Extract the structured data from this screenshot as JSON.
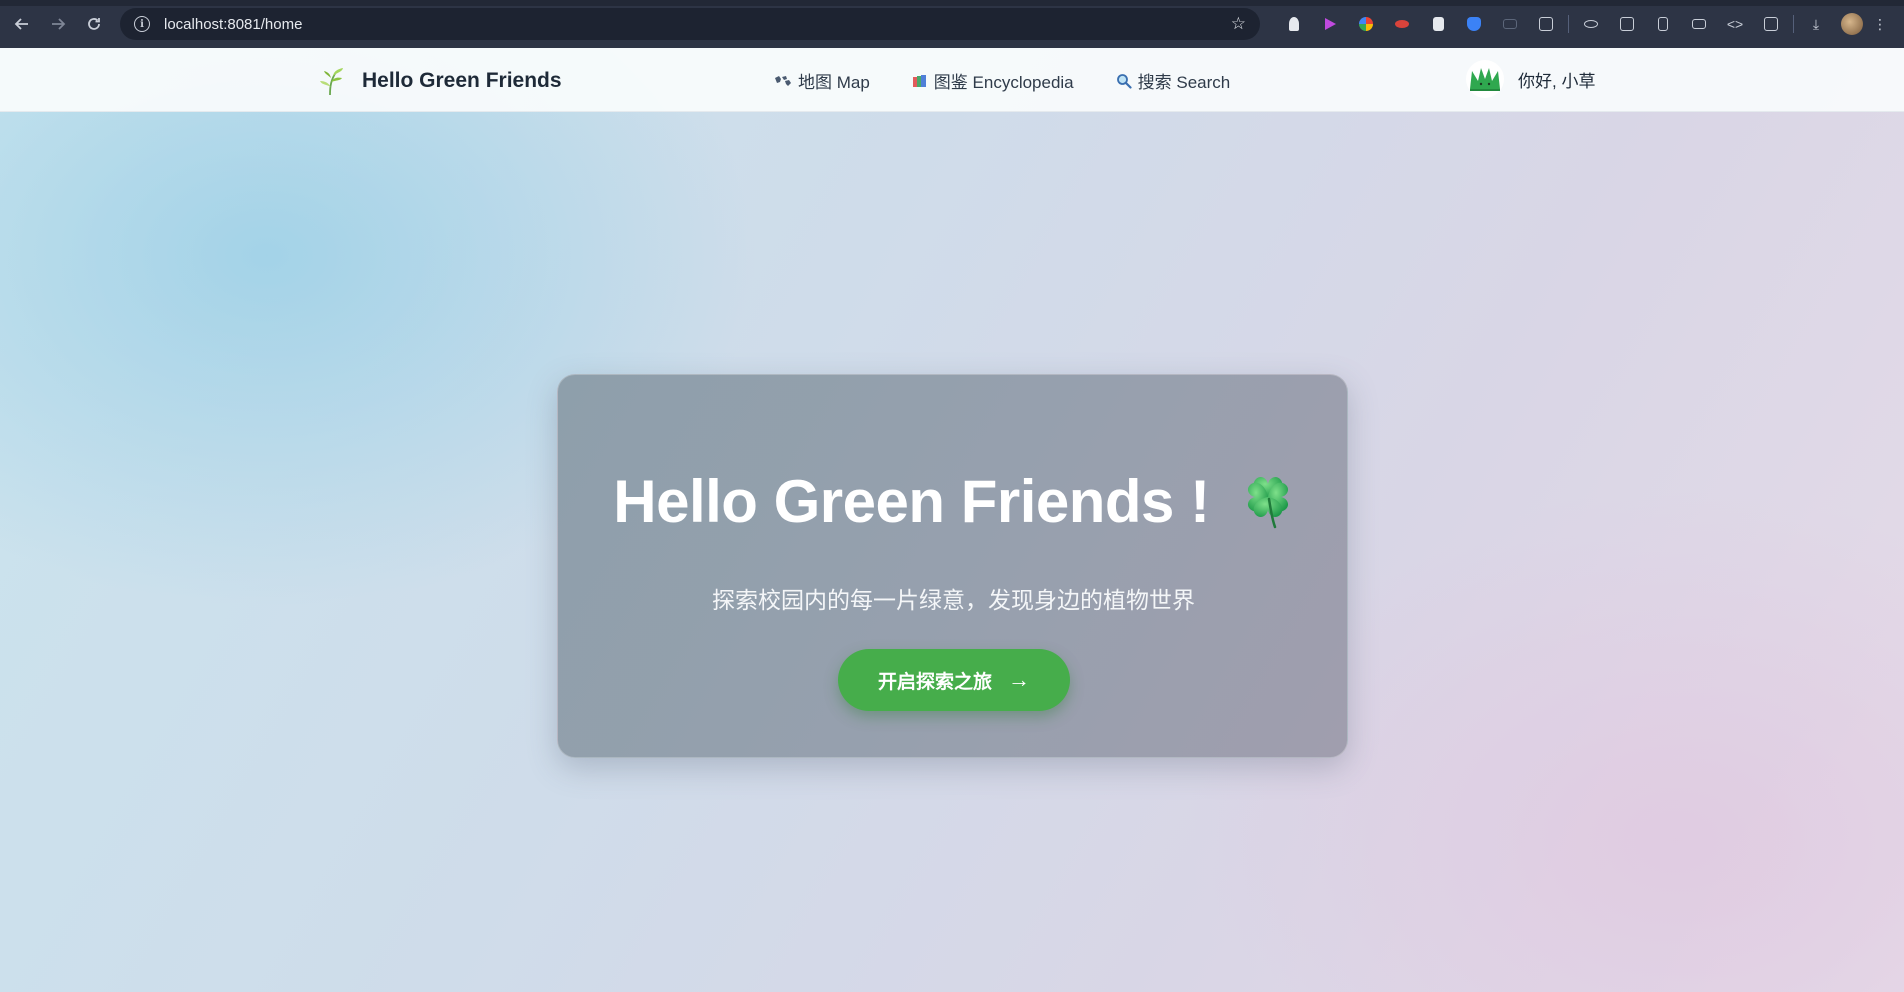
{
  "browser": {
    "url": "localhost:8081/home"
  },
  "nav": {
    "brand_name": "Hello Green Friends",
    "links": [
      {
        "icon": "world-map-icon",
        "label": "地图 Map"
      },
      {
        "icon": "books-icon",
        "label": "图鉴 Encyclopedia"
      },
      {
        "icon": "magnifier-icon",
        "label": "搜索 Search"
      }
    ],
    "greeting": "你好, 小草"
  },
  "hero": {
    "title": "Hello Green Friends !",
    "subtitle": "探索校园内的每一片绿意，发现身边的植物世界",
    "cta_label": "开启探索之旅",
    "cta_arrow": "→"
  },
  "colors": {
    "accent_green": "#46ad4b",
    "card_bg": "#97a0ae",
    "nav_text": "#2f3b4a"
  }
}
